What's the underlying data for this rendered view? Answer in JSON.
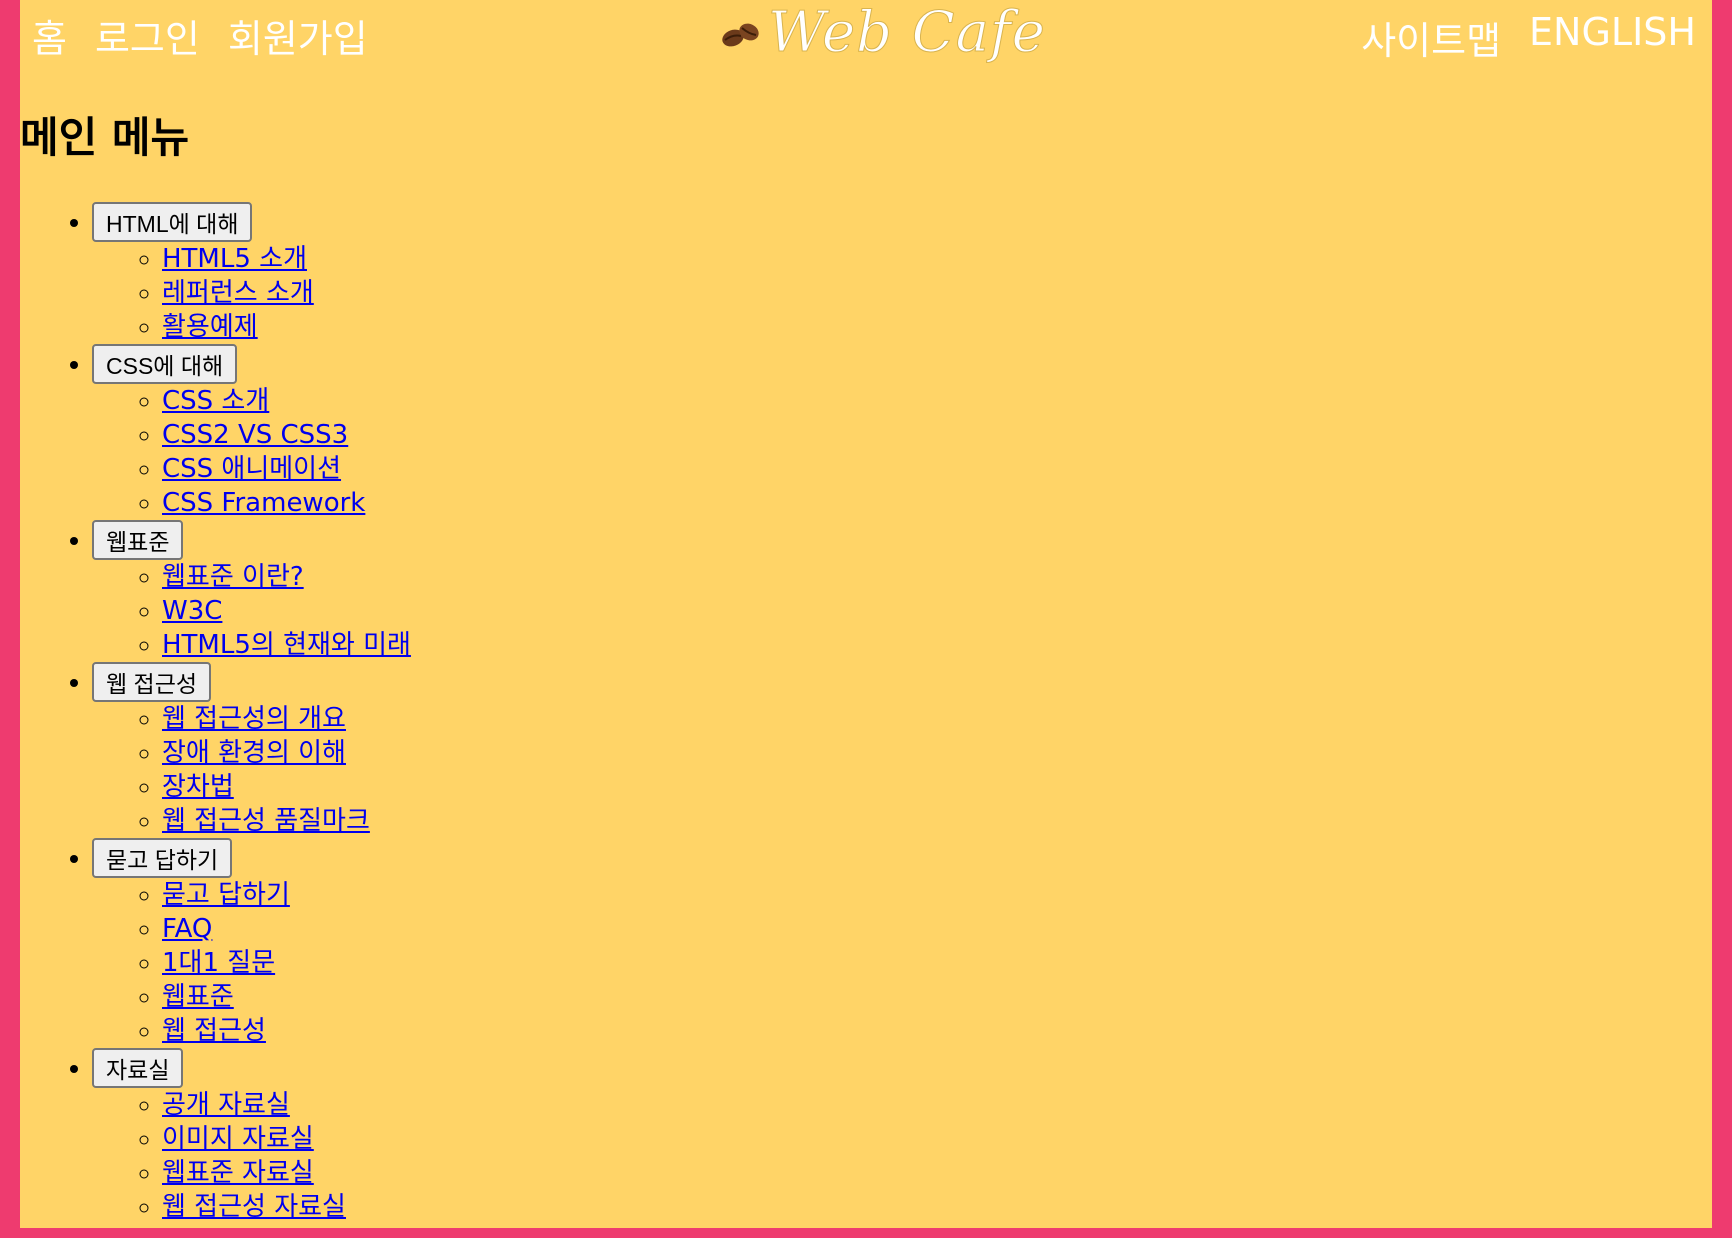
{
  "header": {
    "util_left": [
      "홈",
      "로그인",
      "회원가입"
    ],
    "logo_text": "Web Cafe",
    "util_right": [
      "사이트맵",
      "ENGLISH"
    ]
  },
  "menu_title": "메인 메뉴",
  "menus": [
    {
      "label": "HTML에 대해",
      "items": [
        "HTML5 소개",
        "레퍼런스 소개",
        "활용예제"
      ]
    },
    {
      "label": "CSS에 대해",
      "items": [
        "CSS 소개",
        "CSS2 VS CSS3",
        "CSS 애니메이션",
        "CSS Framework"
      ]
    },
    {
      "label": "웹표준",
      "items": [
        "웹표준 이란?",
        "W3C",
        "HTML5의 현재와 미래"
      ]
    },
    {
      "label": "웹 접근성",
      "items": [
        "웹 접근성의 개요",
        "장애 환경의 이해",
        "장차법",
        "웹 접근성 품질마크"
      ]
    },
    {
      "label": "묻고 답하기",
      "items": [
        "묻고 답하기",
        "FAQ",
        "1대1 질문",
        "웹표준",
        "웹 접근성"
      ]
    },
    {
      "label": "자료실",
      "items": [
        "공개 자료실",
        "이미지 자료실",
        "웹표준 자료실",
        "웹 접근성 자료실"
      ]
    }
  ],
  "colors": {
    "outer_bg": "#ee3b6f",
    "page_bg": "#ffd467",
    "link": "#0000ee"
  }
}
